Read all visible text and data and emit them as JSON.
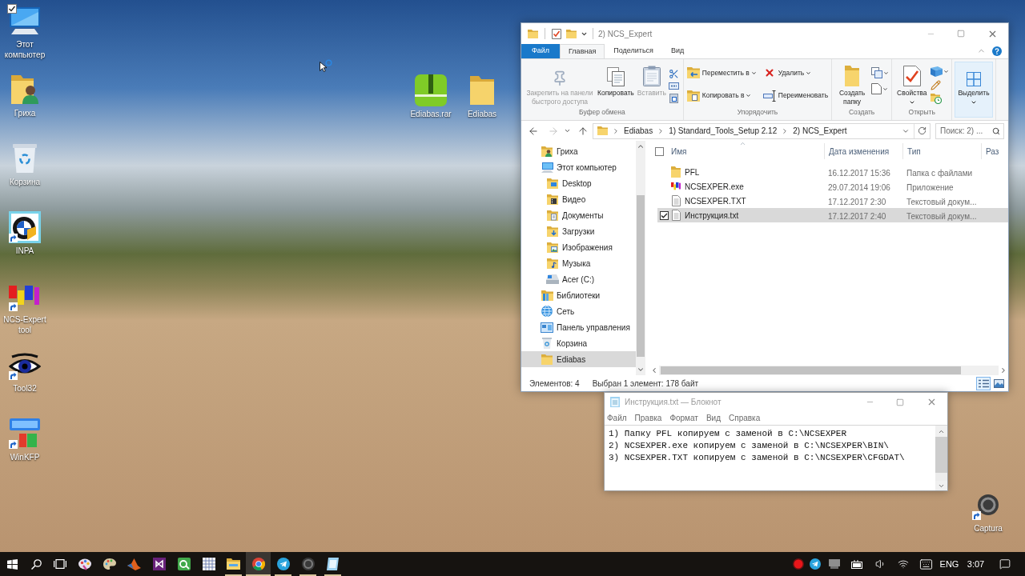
{
  "desktop": {
    "left_icons": [
      {
        "label": "Этот компьютер",
        "kind": "computer",
        "checked": true,
        "shortcut": false
      },
      {
        "label": "Гриха",
        "kind": "user",
        "checked": false,
        "shortcut": false
      },
      {
        "label": "Корзина",
        "kind": "bin",
        "checked": false,
        "shortcut": false
      },
      {
        "label": "INPA",
        "kind": "roundel",
        "checked": false,
        "shortcut": true
      },
      {
        "label": "NCS-Expert tool",
        "kind": "blocks",
        "checked": false,
        "shortcut": true
      },
      {
        "label": "Tool32",
        "kind": "eye",
        "checked": false,
        "shortcut": true
      },
      {
        "label": "WinKFP",
        "kind": "kfp",
        "checked": false,
        "shortcut": true
      }
    ],
    "top_icons": [
      {
        "label": "Ediabas.rar",
        "kind": "archive",
        "checked": false,
        "shortcut": false
      },
      {
        "label": "Ediabas",
        "kind": "folder",
        "checked": false,
        "shortcut": false
      }
    ],
    "corner_icons": [
      {
        "label": "Captura",
        "kind": "ring",
        "checked": false,
        "shortcut": true
      }
    ]
  },
  "explorer": {
    "title": "2) NCS_Expert",
    "ribbon_tabs": [
      {
        "label": "Файл",
        "kind": "file",
        "selected": false
      },
      {
        "label": "Главная",
        "kind": "tab",
        "selected": true
      },
      {
        "label": "Поделиться",
        "kind": "tab",
        "selected": false
      },
      {
        "label": "Вид",
        "kind": "tab",
        "selected": false
      }
    ],
    "ribbon_groups": [
      {
        "kind": "clipboard",
        "label": "Буфер обмена",
        "buttons": [
          {
            "label": "Закрепить на панели быстрого доступа",
            "kind": "pin",
            "disabled": true,
            "dropdown": false
          },
          {
            "label": "Копировать",
            "kind": "copy",
            "disabled": false,
            "dropdown": false
          },
          {
            "label": "Вставить",
            "kind": "paste",
            "disabled": true,
            "dropdown": false
          }
        ]
      },
      {
        "kind": "organize",
        "label": "Упорядочить",
        "buttons": [
          {
            "label": "Переместить в",
            "kind": "move",
            "disabled": false,
            "dropdown": true
          },
          {
            "label": "Копировать в",
            "kind": "copyto",
            "disabled": false,
            "dropdown": true
          },
          {
            "label": "Удалить",
            "kind": "delete",
            "disabled": false,
            "dropdown": true
          },
          {
            "label": "Переименовать",
            "kind": "rename",
            "disabled": false,
            "dropdown": false
          }
        ]
      },
      {
        "kind": "new",
        "label": "Создать",
        "buttons": [
          {
            "label": "Создать папку",
            "kind": "newfolder",
            "disabled": false,
            "dropdown": false
          }
        ]
      },
      {
        "kind": "open",
        "label": "Открыть",
        "buttons": [
          {
            "label": "Свойства",
            "kind": "properties",
            "disabled": false,
            "dropdown": true
          }
        ]
      },
      {
        "kind": "select",
        "buttons": [
          {
            "label": "Выделить",
            "kind": "select",
            "disabled": false,
            "dropdown": true,
            "hovered": true
          }
        ]
      }
    ],
    "address": {
      "back_disabled": false,
      "forward_disabled": true,
      "path": [
        "Ediabas",
        "1) Standard_Tools_Setup 2.12",
        "2) NCS_Expert"
      ],
      "search_placeholder": "Поиск: 2) ..."
    },
    "nav": [
      {
        "label": "Гриха",
        "kind": "user",
        "selected": false
      },
      {
        "label": "Этот компьютер",
        "kind": "computer",
        "selected": false,
        "children": [
          {
            "label": "Desktop",
            "kind": "desktop",
            "selected": false
          },
          {
            "label": "Видео",
            "kind": "video",
            "selected": false
          },
          {
            "label": "Документы",
            "kind": "documents",
            "selected": false
          },
          {
            "label": "Загрузки",
            "kind": "downloads",
            "selected": false
          },
          {
            "label": "Изображения",
            "kind": "pictures",
            "selected": false
          },
          {
            "label": "Музыка",
            "kind": "music",
            "selected": false
          },
          {
            "label": "Acer (C:)",
            "kind": "drive",
            "selected": false
          }
        ]
      },
      {
        "label": "Библиотеки",
        "kind": "libraries",
        "selected": false
      },
      {
        "label": "Сеть",
        "kind": "network",
        "selected": false
      },
      {
        "label": "Панель управления",
        "kind": "control",
        "selected": false
      },
      {
        "label": "Корзина",
        "kind": "bin",
        "selected": false
      },
      {
        "label": "Ediabas",
        "kind": "folder",
        "selected": true
      }
    ],
    "list": {
      "header_checked": false,
      "columns": [
        "Имя",
        "Дата изменения",
        "Тип",
        "Раз"
      ],
      "rows": [
        {
          "name": "PFL",
          "date": "16.12.2017 15:36",
          "type": "Папка с файлами",
          "kind": "folder",
          "selected": false,
          "checked": false
        },
        {
          "name": "NCSEXPER.exe",
          "date": "29.07.2014 19:06",
          "type": "Приложение",
          "kind": "app",
          "selected": false,
          "checked": false
        },
        {
          "name": "NCSEXPER.TXT",
          "date": "17.12.2017 2:30",
          "type": "Текстовый докум...",
          "kind": "text",
          "selected": false,
          "checked": false
        },
        {
          "name": "Инструкция.txt",
          "date": "17.12.2017 2:40",
          "type": "Текстовый докум...",
          "kind": "text",
          "selected": true,
          "checked": true
        }
      ]
    },
    "status": {
      "count": "Элементов: 4",
      "selection": "Выбран 1 элемент: 178 байт",
      "views": [
        {
          "kind": "details",
          "selected": true
        },
        {
          "kind": "tiles",
          "selected": false
        }
      ]
    }
  },
  "notepad": {
    "title": "Инструкция.txt — Блокнот",
    "menu": [
      "Файл",
      "Правка",
      "Формат",
      "Вид",
      "Справка"
    ],
    "lines": [
      "1) Папку PFL копируем с заменой в C:\\NCSEXPER",
      "2) NCSEXPER.exe копируем с заменой в C:\\NCSEXPER\\BIN\\",
      "3) NCSEXPER.TXT копируем с заменой в C:\\NCSEXPER\\CFGDAT\\"
    ]
  },
  "taskbar": {
    "apps": [
      {
        "kind": "paint",
        "running": false,
        "selected": false
      },
      {
        "kind": "palette",
        "running": false,
        "selected": false
      },
      {
        "kind": "peak",
        "running": false,
        "selected": false
      },
      {
        "kind": "loop",
        "running": false,
        "selected": false
      },
      {
        "kind": "leaf",
        "running": false,
        "selected": false
      },
      {
        "kind": "grid",
        "running": false,
        "selected": false
      },
      {
        "kind": "folder",
        "running": true,
        "selected": false
      },
      {
        "kind": "circle",
        "running": true,
        "selected": true
      },
      {
        "kind": "plane",
        "running": true,
        "selected": false
      },
      {
        "kind": "ring",
        "running": true,
        "selected": false
      },
      {
        "kind": "notepad",
        "running": true,
        "selected": false
      }
    ],
    "language": "ENG",
    "time": "3:07"
  }
}
